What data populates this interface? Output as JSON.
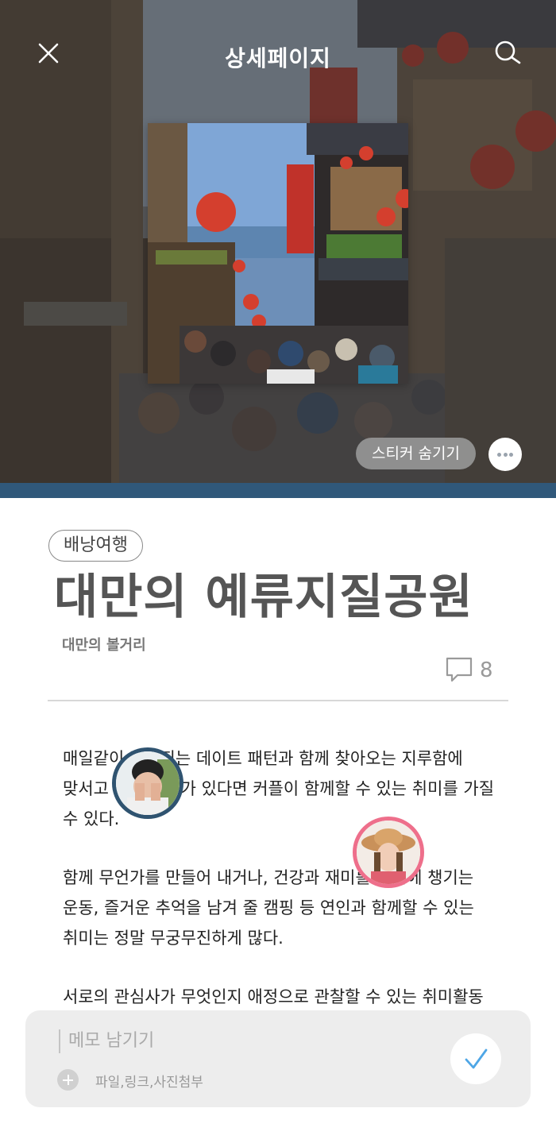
{
  "header": {
    "title": "상세페이지",
    "close_icon": "close-icon",
    "search_icon": "search-icon"
  },
  "hero": {
    "sticker_toggle_label": "스티커 숨기기",
    "more_icon": "more-dots-icon"
  },
  "article": {
    "category": "배낭여행",
    "title": "대만의 예류지질공원",
    "subtitle": "대만의 볼거리",
    "comment_icon": "comment-icon",
    "comment_count": "8",
    "paragraphs": [
      "매일같이 반복되는 데이트 패턴과 함께 찾아오는 지루함에 맞서고 싶은 의지가 있다면 커플이 함께할 수 있는 취미를 가질 수 있다.",
      "함께 무언가를 만들어 내거나, 건강과 재미를 동시에 챙기는 운동, 즐거운 추억을 남겨 줄 캠핑 등 연인과 함께할 수 있는 취미는 정말 무궁무진하게 많다.",
      "서로의 관심사가 무엇인지 애정으로 관찰할 수 있는 취미활동"
    ]
  },
  "memo": {
    "placeholder": "메모 남기기",
    "attach_label": "파일,링크,사진첨부",
    "submit_icon": "check-icon"
  },
  "colors": {
    "hero_strip": "#30587a",
    "avatar_ring_1": "#2f5370",
    "avatar_ring_2": "#ee6f8b",
    "check": "#4ea6e6"
  }
}
